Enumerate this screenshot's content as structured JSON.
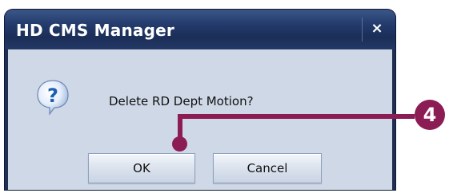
{
  "dialog": {
    "title": "HD CMS Manager",
    "close_label": "×",
    "message": "Delete RD Dept Motion?",
    "icon": "question-icon",
    "buttons": {
      "ok_label": "OK",
      "cancel_label": "Cancel"
    }
  },
  "callout": {
    "number": "4",
    "color": "#8b1c54"
  },
  "colors": {
    "titlebar": "#22396a",
    "body": "#cfd8e6",
    "icon_blue": "#1d5fb0"
  }
}
